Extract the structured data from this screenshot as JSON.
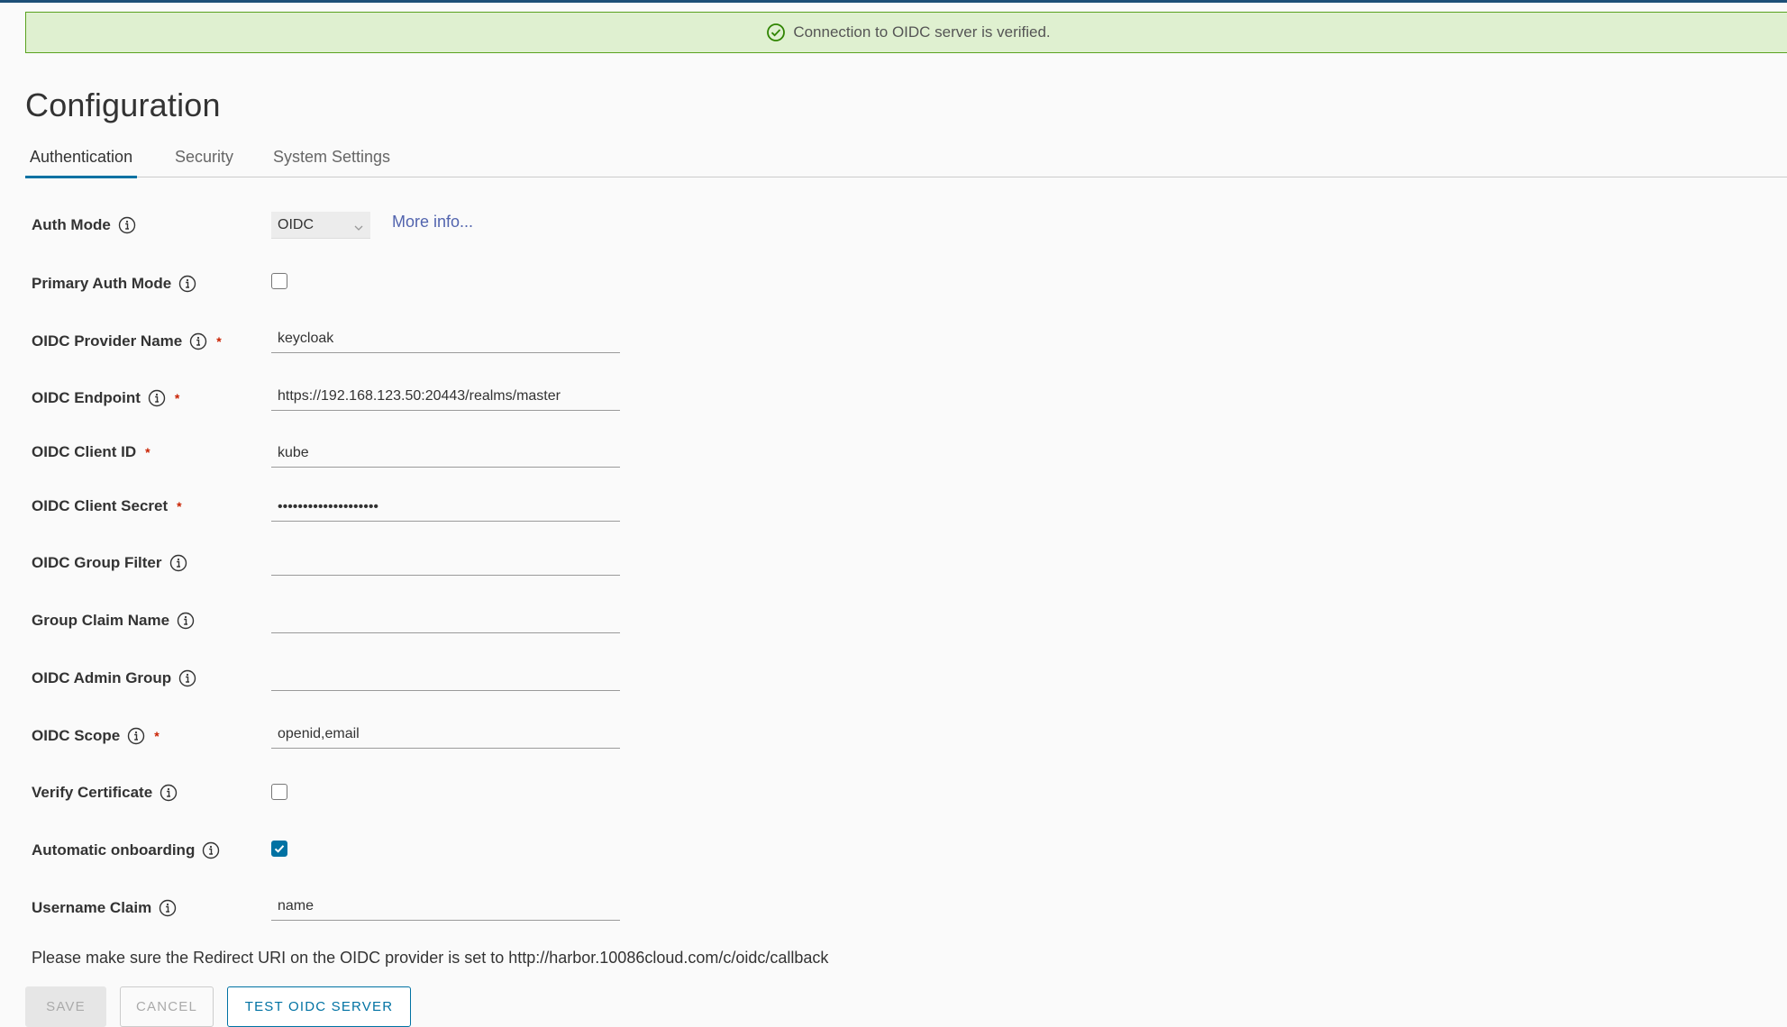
{
  "alert": {
    "message": "Connection to OIDC server is verified."
  },
  "page": {
    "title": "Configuration"
  },
  "tabs": [
    "Authentication",
    "Security",
    "System Settings"
  ],
  "form": {
    "auth_mode": {
      "label": "Auth Mode",
      "value": "OIDC",
      "more_info": "More info..."
    },
    "primary_auth_mode": {
      "label": "Primary Auth Mode",
      "checked": false
    },
    "provider_name": {
      "label": "OIDC Provider Name",
      "value": "keycloak"
    },
    "endpoint": {
      "label": "OIDC Endpoint",
      "value": "https://192.168.123.50:20443/realms/master"
    },
    "client_id": {
      "label": "OIDC Client ID",
      "value": "kube"
    },
    "client_secret": {
      "label": "OIDC Client Secret",
      "value": "••••••••••••••••••••"
    },
    "group_filter": {
      "label": "OIDC Group Filter",
      "value": ""
    },
    "group_claim_name": {
      "label": "Group Claim Name",
      "value": ""
    },
    "admin_group": {
      "label": "OIDC Admin Group",
      "value": ""
    },
    "scope": {
      "label": "OIDC Scope",
      "value": "openid,email"
    },
    "verify_certificate": {
      "label": "Verify Certificate",
      "checked": false
    },
    "automatic_onboarding": {
      "label": "Automatic onboarding",
      "checked": true
    },
    "username_claim": {
      "label": "Username Claim",
      "value": "name"
    }
  },
  "note": "Please make sure the Redirect URI on the OIDC provider is set to http://harbor.10086cloud.com/c/oidc/callback",
  "buttons": {
    "save": "SAVE",
    "cancel": "CANCEL",
    "test": "TEST OIDC SERVER"
  },
  "colors": {
    "accent": "#0072a3",
    "success_bg": "#dff0d0",
    "success_border": "#5aa220",
    "required": "#c92100"
  }
}
